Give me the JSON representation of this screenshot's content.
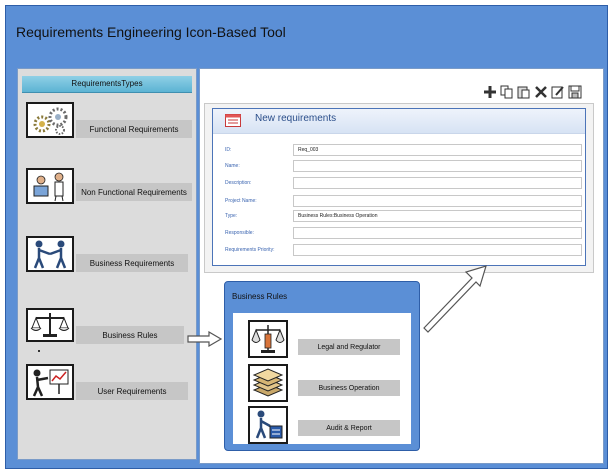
{
  "app": {
    "title": "Requirements Engineering Icon-Based Tool"
  },
  "sidebar": {
    "header": "RequirementsTypes",
    "items": [
      {
        "label": "Functional Requirements",
        "icon": "gears-icon"
      },
      {
        "label": "Non Functional Requirements",
        "icon": "workers-icon"
      },
      {
        "label": "Business Requirements",
        "icon": "handshake-icon"
      },
      {
        "label": "Business Rules",
        "icon": "scales-icon"
      },
      {
        "label": "User Requirements",
        "icon": "user-chart-icon"
      }
    ]
  },
  "toolbar": {
    "buttons": [
      "add-icon",
      "copy-icon",
      "paste-icon",
      "delete-icon",
      "edit-icon",
      "save-icon"
    ]
  },
  "form": {
    "title": "New requirements",
    "fields": [
      {
        "label": "ID:",
        "value": "Req_003"
      },
      {
        "label": "Name:",
        "value": ""
      },
      {
        "label": "Description:",
        "value": ""
      },
      {
        "label": "Project Name:",
        "value": ""
      },
      {
        "label": "Type:",
        "value": "Business Rules:Business Operation"
      },
      {
        "label": "Responsible:",
        "value": ""
      },
      {
        "label": "Requirements Priority:",
        "value": ""
      }
    ]
  },
  "business_rules": {
    "title": "Business Rules",
    "items": [
      {
        "label": "Legal and Regulator",
        "icon": "law-icon"
      },
      {
        "label": "Business Operation",
        "icon": "documents-stack-icon"
      },
      {
        "label": "Audit & Report",
        "icon": "auditor-icon"
      }
    ]
  },
  "colors": {
    "frame": "#5b8fd6",
    "header_cyan": "#5cb3d3",
    "label_gray": "#c6c6c6"
  }
}
